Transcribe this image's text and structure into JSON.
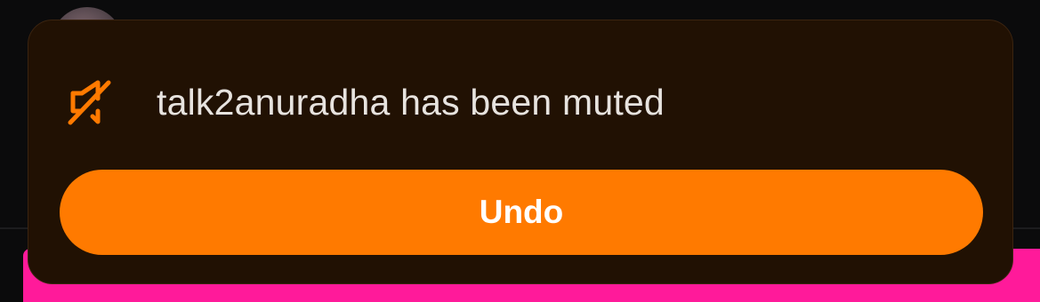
{
  "toast": {
    "message": "talk2anuradha has been muted",
    "icon": "mute-speaker-icon",
    "undo_label": "Undo"
  },
  "colors": {
    "accent": "#ff7a00",
    "toast_background": "#211103",
    "page_background": "#0b0b0c",
    "message_text": "#e7e3df",
    "pink_card": "#ff1a9a"
  }
}
